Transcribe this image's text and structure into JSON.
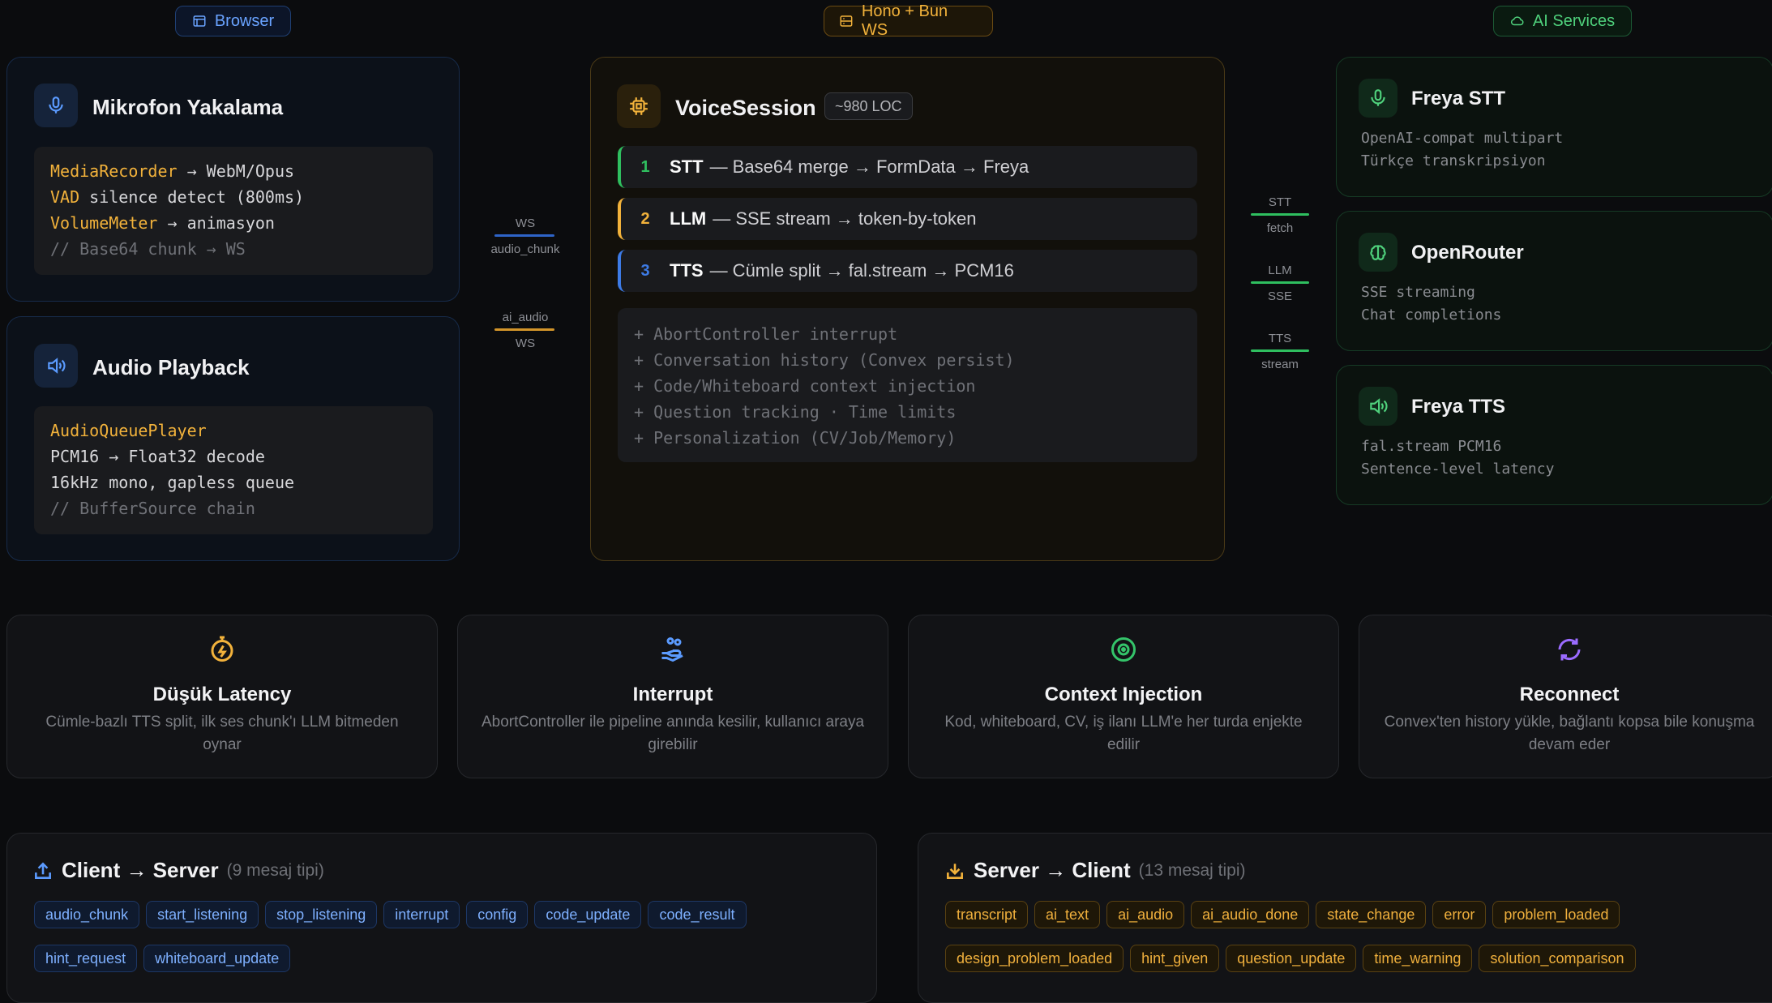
{
  "header": {
    "browser": "Browser",
    "server": "Hono + Bun WS",
    "ai": "AI Services"
  },
  "mic": {
    "title": "Mikrofon Yakalama",
    "lines": [
      {
        "kw": "MediaRecorder",
        "rest": " → WebM/Opus"
      },
      {
        "kw": "VAD",
        "rest": " silence detect (800ms)"
      },
      {
        "kw": "VolumeMeter",
        "rest": " → animasyon"
      }
    ],
    "comment": "// Base64 chunk → WS"
  },
  "playback": {
    "title": "Audio Playback",
    "kw": "AudioQueuePlayer",
    "line2": "PCM16 → Float32 decode",
    "line3": "16kHz mono, gapless queue",
    "comment": "// BufferSource chain"
  },
  "links_left": {
    "ws_top": "WS",
    "audio_chunk": "audio_chunk",
    "ai_audio": "ai_audio",
    "ws_bottom": "WS"
  },
  "voice": {
    "title": "VoiceSession",
    "badge": "~980 LOC",
    "steps": [
      {
        "num": "1",
        "name": "STT",
        "text": "— Base64 merge → FormData → Freya",
        "color": "#2fbf5f"
      },
      {
        "num": "2",
        "name": "LLM",
        "text": "— SSE stream → token-by-token",
        "color": "#f2b23b"
      },
      {
        "num": "3",
        "name": "TTS",
        "text": "— Cümle split → fal.stream → PCM16",
        "color": "#3d7be6"
      }
    ],
    "extras": [
      "+ AbortController interrupt",
      "+ Conversation history (Convex persist)",
      "+ Code/Whiteboard context injection",
      "+ Question tracking · Time limits",
      "+ Personalization (CV/Job/Memory)"
    ]
  },
  "links_right": [
    {
      "top": "STT",
      "bottom": "fetch"
    },
    {
      "top": "LLM",
      "bottom": "SSE"
    },
    {
      "top": "TTS",
      "bottom": "stream"
    }
  ],
  "services": [
    {
      "title": "Freya STT",
      "sub": "OpenAI-compat multipart\nTürkçe transkripsiyon"
    },
    {
      "title": "OpenRouter",
      "sub": "SSE streaming\nChat completions"
    },
    {
      "title": "Freya TTS",
      "sub": "fal.stream PCM16\nSentence-level latency"
    }
  ],
  "features": [
    {
      "title": "Düşük Latency",
      "desc": "Cümle-bazlı TTS split, ilk ses chunk'ı LLM bitmeden oynar",
      "icon": "stopwatch-icon",
      "color": "#f2b23b"
    },
    {
      "title": "Interrupt",
      "desc": "AbortController ile pipeline anında kesilir, kullanıcı araya girebilir",
      "icon": "hand-icon",
      "color": "#5b9bff"
    },
    {
      "title": "Context Injection",
      "desc": "Kod, whiteboard, CV, iş ilanı LLM'e her turda enjekte edilir",
      "icon": "eye-icon",
      "color": "#34c46a"
    },
    {
      "title": "Reconnect",
      "desc": "Convex'ten history yükle, bağlantı kopsa bile konuşma devam eder",
      "icon": "refresh-icon",
      "color": "#9b6bff"
    }
  ],
  "client_server": {
    "title": "Client → Server",
    "count": "(9 mesaj tipi)",
    "tags": [
      "audio_chunk",
      "start_listening",
      "stop_listening",
      "interrupt",
      "config",
      "code_update",
      "code_result",
      "hint_request",
      "whiteboard_update"
    ]
  },
  "server_client": {
    "title": "Server → Client",
    "count": "(13 mesaj tipi)",
    "tags": [
      "transcript",
      "ai_text",
      "ai_audio",
      "ai_audio_done",
      "state_change",
      "error",
      "problem_loaded",
      "design_problem_loaded",
      "hint_given",
      "question_update",
      "time_warning",
      "solution_comparison"
    ]
  }
}
